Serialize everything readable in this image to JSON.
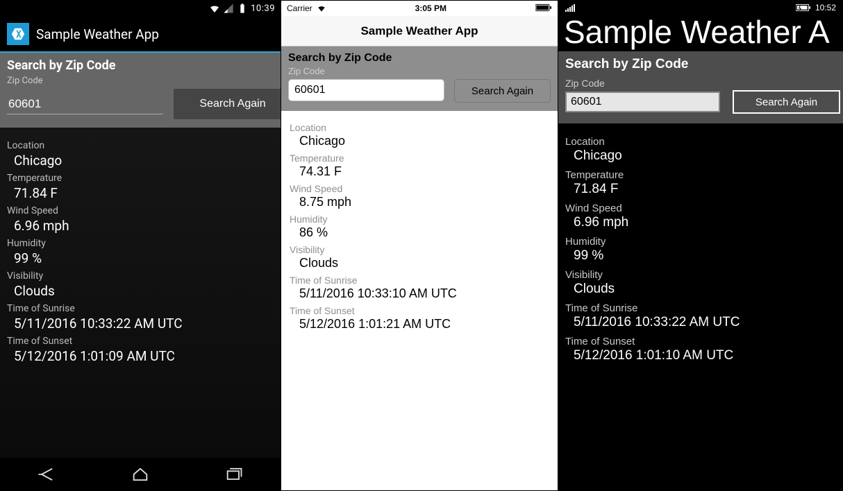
{
  "android": {
    "statusbar": {
      "time": "10:39"
    },
    "appbar": {
      "title": "Sample Weather App"
    },
    "search": {
      "heading": "Search by Zip Code",
      "zip_label": "Zip Code",
      "zip_value": "60601",
      "button": "Search Again"
    },
    "results": {
      "location_label": "Location",
      "location_value": "Chicago",
      "temp_label": "Temperature",
      "temp_value": "71.84 F",
      "wind_label": "Wind Speed",
      "wind_value": "6.96 mph",
      "humidity_label": "Humidity",
      "humidity_value": "99 %",
      "visibility_label": "Visibility",
      "visibility_value": "Clouds",
      "sunrise_label": "Time of Sunrise",
      "sunrise_value": "5/11/2016 10:33:22 AM UTC",
      "sunset_label": "Time of Sunset",
      "sunset_value": "5/12/2016 1:01:09 AM UTC"
    }
  },
  "ios": {
    "statusbar": {
      "carrier": "Carrier",
      "time": "3:05 PM"
    },
    "header": {
      "title": "Sample Weather App"
    },
    "search": {
      "heading": "Search by Zip Code",
      "zip_label": "Zip Code",
      "zip_value": "60601",
      "button": "Search Again"
    },
    "results": {
      "location_label": "Location",
      "location_value": "Chicago",
      "temp_label": "Temperature",
      "temp_value": "74.31 F",
      "wind_label": "Wind Speed",
      "wind_value": "8.75 mph",
      "humidity_label": "Humidity",
      "humidity_value": "86 %",
      "visibility_label": "Visibility",
      "visibility_value": "Clouds",
      "sunrise_label": "Time of Sunrise",
      "sunrise_value": "5/11/2016 10:33:10 AM UTC",
      "sunset_label": "Time of Sunset",
      "sunset_value": "5/12/2016 1:01:21 AM UTC"
    }
  },
  "wp": {
    "statusbar": {
      "time": "10:52"
    },
    "title": "Sample Weather A",
    "search": {
      "heading": "Search by Zip Code",
      "zip_label": "Zip Code",
      "zip_value": "60601",
      "button": "Search Again"
    },
    "results": {
      "location_label": "Location",
      "location_value": "Chicago",
      "temp_label": "Temperature",
      "temp_value": "71.84 F",
      "wind_label": "Wind Speed",
      "wind_value": "6.96 mph",
      "humidity_label": "Humidity",
      "humidity_value": "99 %",
      "visibility_label": "Visibility",
      "visibility_value": "Clouds",
      "sunrise_label": "Time of Sunrise",
      "sunrise_value": "5/11/2016 10:33:22 AM UTC",
      "sunset_label": "Time of Sunset",
      "sunset_value": "5/12/2016 1:01:10 AM UTC"
    }
  }
}
